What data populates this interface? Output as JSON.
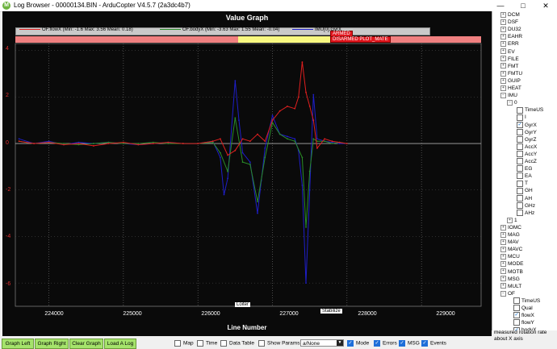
{
  "window": {
    "title": "Log Browser - 00000134.BIN - ArduCopter V4.5.7 (2a3dc4b7)",
    "minimize": "—",
    "maximize": "□",
    "close": "✕"
  },
  "graph": {
    "title": "Value Graph",
    "xlabel": "Line Number",
    "legend": [
      {
        "label": "OF.flowX  (Min: -1.6 Max: 3.56 Mean: 0.18)",
        "color": "#e01f1f"
      },
      {
        "label": "OF.bodyX  (Min: -3.63 Max: 1.55 Mean: -0.04)",
        "color": "#2a8c2a"
      },
      {
        "label": "IMU[0].GyrX",
        "color": "#1e1ec8"
      }
    ],
    "events": [
      "ARMED",
      "DISARMED PLOT_MATE"
    ],
    "modes": [
      "Loiter",
      "Stabilize"
    ],
    "yticks": [
      "4",
      "2",
      "0",
      "-2",
      "-4",
      "-6"
    ],
    "xticks": [
      "224000",
      "225000",
      "226000",
      "227000",
      "228000",
      "229000"
    ]
  },
  "chart_data": {
    "type": "line",
    "title": "Value Graph",
    "xlabel": "Line Number",
    "ylabel": "",
    "xlim": [
      223550,
      229800
    ],
    "ylim": [
      -7,
      4.3
    ],
    "grid": true,
    "legend_position": "top",
    "series": [
      {
        "name": "OF.flowX",
        "x": [
          223600,
          223800,
          224000,
          224200,
          224400,
          224600,
          224800,
          225000,
          225200,
          225400,
          225600,
          225800,
          226000,
          226200,
          226300,
          226400,
          226500,
          226600,
          226700,
          226800,
          226900,
          227000,
          227100,
          227200,
          227300,
          227350,
          227400,
          227450,
          227500,
          227550,
          227600,
          227700,
          227800,
          227900,
          228000
        ],
        "y": [
          0.1,
          0.0,
          0.05,
          -0.05,
          0.0,
          -0.1,
          0.0,
          0.05,
          -0.05,
          0.0,
          0.05,
          0.0,
          0.0,
          0.1,
          0.2,
          -0.5,
          -0.3,
          0.2,
          0.1,
          0.4,
          0.1,
          1.0,
          1.4,
          1.6,
          1.5,
          2.0,
          3.5,
          2.2,
          1.6,
          1.0,
          -0.2,
          0.2,
          0.1,
          0.05,
          0.0
        ]
      },
      {
        "name": "OF.bodyX",
        "x": [
          223600,
          223800,
          224000,
          224200,
          224400,
          224600,
          224800,
          225000,
          225200,
          225400,
          225600,
          225800,
          226000,
          226200,
          226300,
          226400,
          226500,
          226600,
          226700,
          226800,
          226900,
          227000,
          227100,
          227200,
          227300,
          227400,
          227450,
          227500,
          227550,
          227600,
          227700,
          227800,
          227900,
          228000
        ],
        "y": [
          0.1,
          0.0,
          0.05,
          0.0,
          -0.05,
          0.0,
          0.05,
          0.0,
          0.0,
          0.05,
          0.0,
          0.0,
          0.0,
          0.05,
          -0.4,
          -1.2,
          1.1,
          -0.8,
          -0.9,
          -2.5,
          -0.6,
          0.9,
          0.4,
          0.2,
          0.1,
          -0.6,
          -3.6,
          -1.2,
          0.2,
          0.1,
          0.1,
          0.0,
          0.05,
          0.0
        ]
      },
      {
        "name": "IMU[0].GyrX",
        "x": [
          223600,
          223800,
          224000,
          224200,
          224400,
          224600,
          224800,
          225000,
          225200,
          225400,
          225600,
          225800,
          226000,
          226200,
          226300,
          226350,
          226400,
          226500,
          226550,
          226600,
          226700,
          226800,
          226850,
          226900,
          227000,
          227100,
          227200,
          227300,
          227350,
          227400,
          227450,
          227500,
          227550,
          227600,
          227700,
          227800,
          227900,
          228000
        ],
        "y": [
          0.2,
          0.0,
          0.1,
          -0.05,
          0.05,
          0.0,
          0.05,
          0.0,
          -0.05,
          0.0,
          0.05,
          0.0,
          0.0,
          0.1,
          -0.6,
          -2.2,
          -1.5,
          2.7,
          1.0,
          -0.4,
          -0.8,
          -3.0,
          -1.6,
          -0.2,
          1.2,
          0.4,
          0.3,
          0.2,
          -0.3,
          -1.8,
          -6.0,
          -2.0,
          2.1,
          0.2,
          0.1,
          0.05,
          0.0,
          0.0
        ]
      }
    ]
  },
  "tree": {
    "top": [
      "DCM",
      "DSF",
      "DU32",
      "EAHR",
      "ERR",
      "EV",
      "FILE",
      "FMT",
      "FMTU",
      "GUIP",
      "HEAT",
      "IMU"
    ],
    "imu_inst": "0",
    "imu_fields": [
      {
        "label": "TimeUS",
        "checked": false
      },
      {
        "label": "I",
        "checked": false
      },
      {
        "label": "GyrX",
        "checked": true
      },
      {
        "label": "GyrY",
        "checked": false
      },
      {
        "label": "GyrZ",
        "checked": false
      },
      {
        "label": "AccX",
        "checked": false
      },
      {
        "label": "AccY",
        "checked": false
      },
      {
        "label": "AccZ",
        "checked": false
      },
      {
        "label": "EG",
        "checked": false
      },
      {
        "label": "EA",
        "checked": false
      },
      {
        "label": "T",
        "checked": false
      },
      {
        "label": "GH",
        "checked": false
      },
      {
        "label": "AH",
        "checked": false
      },
      {
        "label": "GHz",
        "checked": false
      },
      {
        "label": "AHz",
        "checked": false
      }
    ],
    "imu_inst2": "1",
    "mid": [
      "IOMC",
      "MAG",
      "MAV",
      "MAVC",
      "MCU",
      "MODE",
      "MOTB",
      "MSG",
      "MULT",
      "OF"
    ],
    "of_fields": [
      {
        "label": "TimeUS",
        "checked": false
      },
      {
        "label": "Qual",
        "checked": false
      },
      {
        "label": "flowX",
        "checked": true
      },
      {
        "label": "flowY",
        "checked": false
      },
      {
        "label": "bodyX",
        "checked": true
      },
      {
        "label": "bodyY",
        "checked": false
      }
    ],
    "last": "PARM",
    "hint": "measured rotation rate about X axis"
  },
  "bottom": {
    "graph_left": "Graph Left",
    "graph_right": "Graph Right",
    "clear_graph": "Clear Graph",
    "load_log": "Load A Log",
    "map": "Map",
    "time": "Time",
    "data_table": "Data Table",
    "show_params": "Show Params",
    "select_value": "a/None",
    "mode": "Mode",
    "errors": "Errors",
    "msg": "MSG",
    "events": "Events"
  }
}
